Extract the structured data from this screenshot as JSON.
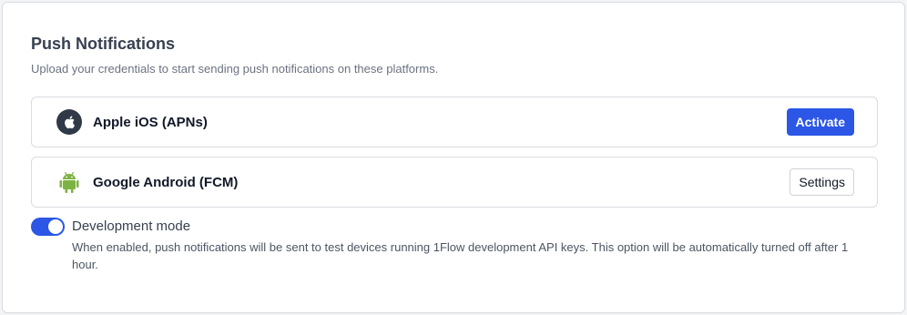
{
  "section": {
    "title": "Push Notifications",
    "subtitle": "Upload your credentials to start sending push notifications on these platforms."
  },
  "platforms": [
    {
      "name": "Apple iOS (APNs)",
      "icon": "apple-icon",
      "action_label": "Activate"
    },
    {
      "name": "Google Android (FCM)",
      "icon": "android-icon",
      "action_label": "Settings"
    }
  ],
  "development_mode": {
    "label": "Development mode",
    "enabled": true,
    "description": "When enabled, push notifications will be sent to test devices running 1Flow development API keys. This option will be automatically turned off after 1 hour."
  },
  "colors": {
    "accent": "#2b56e6",
    "android_green": "#7cb342",
    "apple_dark": "#2f3947"
  }
}
